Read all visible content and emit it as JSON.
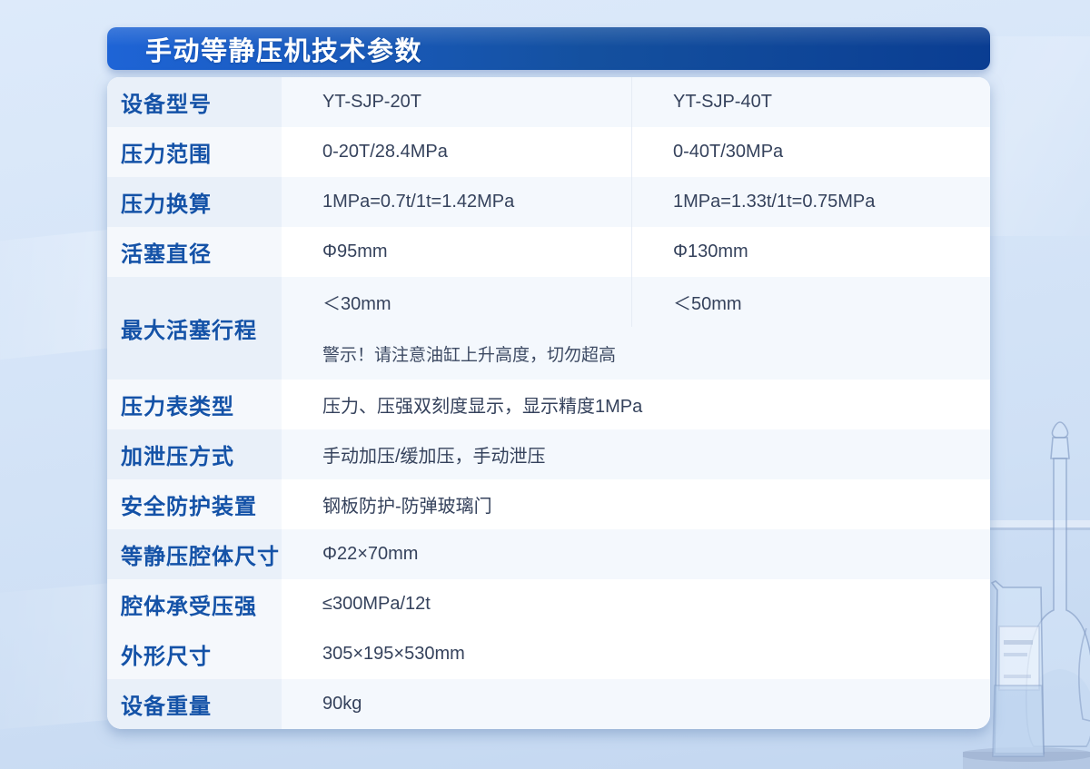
{
  "page": {
    "title": "手动等静压机技术参数"
  },
  "table": {
    "rows": [
      {
        "label": "设备型号",
        "col1": "YT-SJP-20T",
        "col2": "YT-SJP-40T"
      },
      {
        "label": "压力范围",
        "col1": "0-20T/28.4MPa",
        "col2": "0-40T/30MPa"
      },
      {
        "label": "压力换算",
        "col1": "1MPa=0.7t/1t=1.42MPa",
        "col2": "1MPa=1.33t/1t=0.75MPa"
      },
      {
        "label": "活塞直径",
        "col1": "Φ95mm",
        "col2": "Φ130mm"
      },
      {
        "label": "最大活塞行程",
        "col1": "＜30mm",
        "col2": "＜50mm",
        "warning": "警示！请注意油缸上升高度，切勿超高"
      },
      {
        "label": "压力表类型",
        "value": "压力、压强双刻度显示，显示精度1MPa"
      },
      {
        "label": "加泄压方式",
        "value": "手动加压/缓加压，手动泄压"
      },
      {
        "label": "安全防护装置",
        "value": "钢板防护-防弹玻璃门"
      },
      {
        "label": "等静压腔体尺寸",
        "value": "Φ22×70mm"
      },
      {
        "label": "腔体承受压强",
        "value": "≤300MPa/12t"
      },
      {
        "label": "外形尺寸",
        "value": "305×195×530mm"
      },
      {
        "label": "设备重量",
        "value": "90kg"
      }
    ]
  },
  "colors": {
    "header_gradient_left": "#1E64D6",
    "header_gradient_right": "#0A3D92",
    "label_text": "#1452A7",
    "value_text": "#35425C",
    "warning_text": "#3D4A63",
    "row_shaded_bg": "#F4F8FD",
    "row_shaded_label_bg": "#E9F0F9",
    "row_white_label_bg": "#F5F8FC",
    "column_divider": "#E6ECF5",
    "page_bg_top": "#DDEAFA",
    "page_bg_bottom": "#C2D6F0"
  }
}
